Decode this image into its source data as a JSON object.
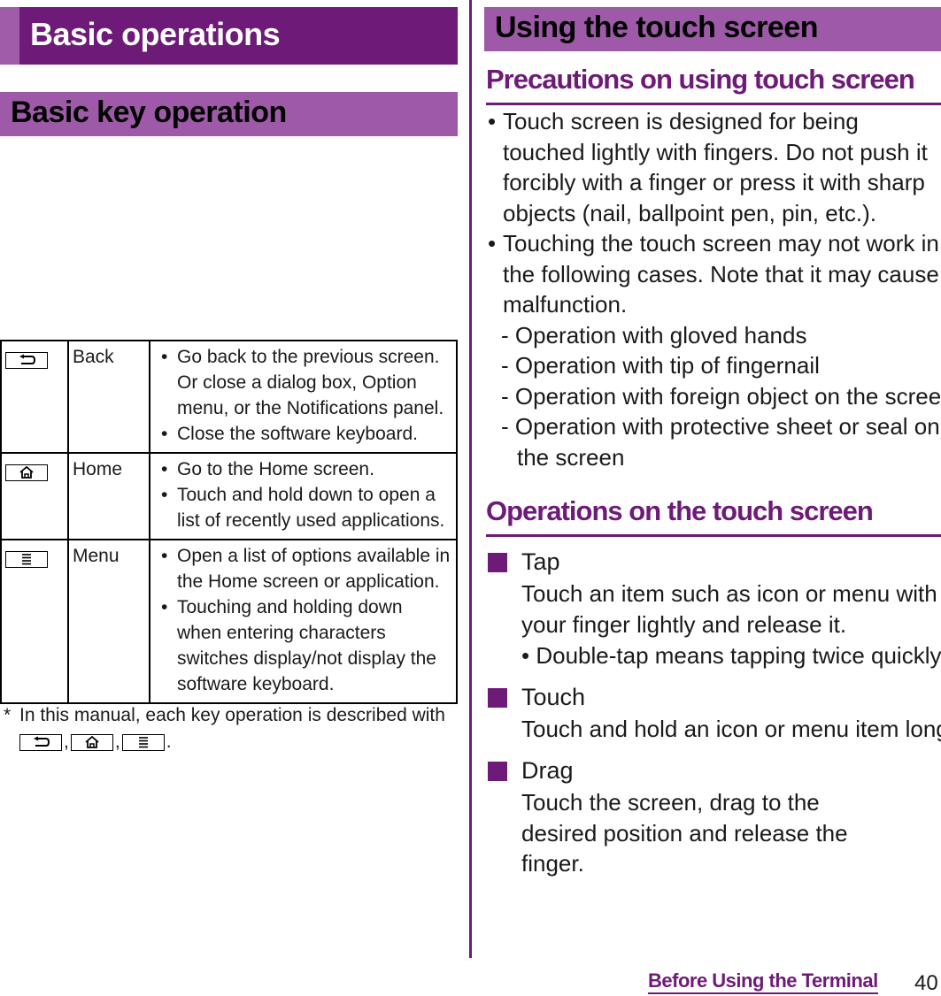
{
  "left": {
    "chapter_title": "Basic operations",
    "section_title": "Basic key operation",
    "key_table": [
      {
        "icon": "back-key-icon",
        "name": "Back",
        "bullets": [
          "Go back to the previous screen. Or close a dialog box, Option menu, or the Notifications panel.",
          "Close the software keyboard."
        ]
      },
      {
        "icon": "home-key-icon",
        "name": "Home",
        "bullets": [
          "Go to the Home screen.",
          "Touch and hold down to open a list of recently used applications."
        ]
      },
      {
        "icon": "menu-key-icon",
        "name": "Menu",
        "bullets": [
          "Open a list of options available in the Home screen or application.",
          "Touching and holding down when entering characters switches display/not display the software keyboard."
        ]
      }
    ],
    "note": {
      "marker": "*",
      "text": "In this manual, each key operation is described with",
      "separator": ",",
      "terminator": "."
    }
  },
  "right": {
    "section_title": "Using the touch screen",
    "precautions": {
      "heading": "Precautions on using touch screen",
      "bullets": [
        {
          "text": "Touch screen is designed for being touched lightly with fingers. Do not push it forcibly with a finger or press it with sharp objects (nail, ballpoint pen, pin, etc.)."
        },
        {
          "text": "Touching the touch screen may not work in the following cases. Note that it may cause malfunction.",
          "sub_items": [
            "Operation with gloved hands",
            "Operation with tip of fingernail",
            "Operation with foreign object on the screen",
            "Operation with protective sheet or seal on",
            "the screen"
          ]
        }
      ]
    },
    "operations": {
      "heading": "Operations on the touch screen",
      "items": [
        {
          "title": "Tap",
          "body": "Touch an item such as icon or menu with your finger lightly and release it.",
          "note": "Double-tap means tapping twice quickly."
        },
        {
          "title": "Touch",
          "body": "Touch and hold an icon or menu item long."
        },
        {
          "title": "Drag",
          "body": "Touch the screen, drag to the desired position and release the finger."
        }
      ]
    }
  },
  "footer": {
    "chapter_link": "Before Using the Terminal",
    "page_number": "40"
  },
  "bullet_char": "•",
  "dash_char": "-",
  "colors": {
    "chapter_bar": "#6e1a78",
    "chapter_bar_accent": "#a05ca8",
    "section_bar": "#9e5aa8",
    "heading_text": "#6e1a78"
  }
}
